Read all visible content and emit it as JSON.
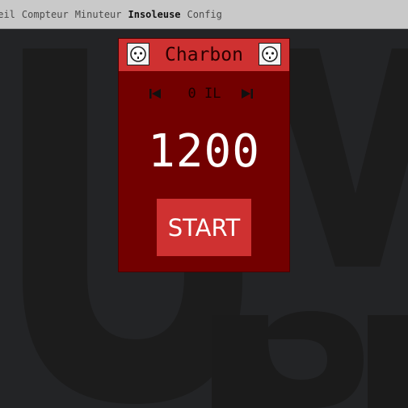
{
  "nav": {
    "items": [
      {
        "label": "ueil",
        "active": false
      },
      {
        "label": "Compteur",
        "active": false
      },
      {
        "label": "Minuteur",
        "active": false
      },
      {
        "label": "Insoleuse",
        "active": true
      },
      {
        "label": "Config",
        "active": false
      }
    ]
  },
  "panel": {
    "title": "Charbon",
    "left_icon": "socket-icon",
    "right_icon": "socket-icon",
    "controls": {
      "prev_icon": "skip-previous-icon",
      "label": "0 IL",
      "next_icon": "skip-next-icon"
    },
    "counter": "1200",
    "start_label": "START"
  },
  "colors": {
    "card_bg": "#730000",
    "accent": "#cf3131",
    "topbar_bg": "#c9c9c9",
    "page_bg": "#232426"
  }
}
